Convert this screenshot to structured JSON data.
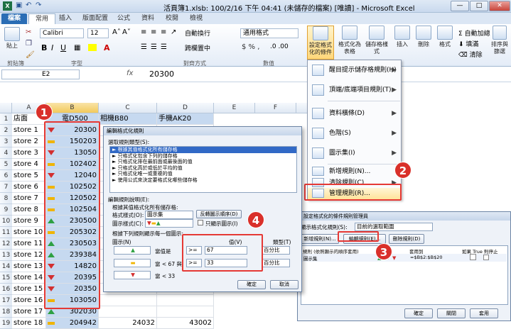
{
  "window": {
    "title": "活頁簿1.xlsb: 100/2/16 下午 04:41 (未儲存的檔案) [唯讀] - Microsoft Excel",
    "minimize": "—",
    "maximize": "□",
    "close": "✕"
  },
  "tabs": [
    {
      "label": "檔案"
    },
    {
      "label": "常用"
    },
    {
      "label": "插入"
    },
    {
      "label": "版面配置"
    },
    {
      "label": "公式"
    },
    {
      "label": "資料"
    },
    {
      "label": "校閱"
    },
    {
      "label": "檢視"
    }
  ],
  "ribbon": {
    "paste": "貼上",
    "font": "Calibri",
    "size": "12",
    "wrap": "自動換行",
    "numfmt": "通用格式",
    "merge": "跨欄置中",
    "cond_format": "設定格式化的條件",
    "table_format": "格式化為表格",
    "cell_style": "儲存格樣式",
    "insert": "插入",
    "delete": "刪除",
    "format": "格式",
    "autosum": "自動加總",
    "fill": "填滿",
    "clear": "清除",
    "sort": "排序與篩選",
    "groups": {
      "clipboard": "剪貼簿",
      "font": "字型",
      "align": "對齊方式",
      "number": "數值"
    }
  },
  "formula": {
    "namebox": "E2",
    "fx": "fx",
    "value": "20300"
  },
  "columns": [
    "A",
    "B",
    "C",
    "D",
    "E",
    "F",
    "G"
  ],
  "headers": {
    "a": "店面",
    "b": "電D500",
    "c": "相機B80",
    "d": "手機AK20"
  },
  "rows": [
    {
      "n": "1"
    },
    {
      "n": "2",
      "a": "store 1",
      "b": "20300",
      "icon": "down"
    },
    {
      "n": "3",
      "a": "store 2",
      "b": "150203",
      "icon": "mid"
    },
    {
      "n": "4",
      "a": "store 3",
      "b": "13050",
      "icon": "down"
    },
    {
      "n": "5",
      "a": "store 4",
      "b": "102402",
      "icon": "mid"
    },
    {
      "n": "6",
      "a": "store 5",
      "b": "12040",
      "icon": "down"
    },
    {
      "n": "7",
      "a": "store 6",
      "b": "102502",
      "icon": "mid"
    },
    {
      "n": "8",
      "a": "store 7",
      "b": "120502",
      "icon": "mid"
    },
    {
      "n": "9",
      "a": "store 8",
      "b": "102504",
      "icon": "mid"
    },
    {
      "n": "10",
      "a": "store 9",
      "b": "230500",
      "icon": "up"
    },
    {
      "n": "11",
      "a": "store 10",
      "b": "205302",
      "icon": "mid"
    },
    {
      "n": "12",
      "a": "store 11",
      "b": "230503",
      "icon": "up"
    },
    {
      "n": "13",
      "a": "store 12",
      "b": "239384",
      "icon": "up"
    },
    {
      "n": "14",
      "a": "store 13",
      "b": "14820",
      "icon": "down"
    },
    {
      "n": "15",
      "a": "store 14",
      "b": "20395",
      "icon": "down"
    },
    {
      "n": "16",
      "a": "store 15",
      "b": "20350",
      "icon": "down"
    },
    {
      "n": "17",
      "a": "store 16",
      "b": "103050",
      "icon": "mid"
    },
    {
      "n": "18",
      "a": "store 17",
      "b": "302030",
      "icon": "up"
    },
    {
      "n": "19",
      "a": "store 18",
      "b": "204942",
      "icon": "mid"
    },
    {
      "n": "20",
      "a": "store 19",
      "b": "20501",
      "icon": "down",
      "c": "50304",
      "d": "43002"
    },
    {
      "n": "21"
    }
  ],
  "row19_partial": {
    "c": "24032",
    "d": "43002"
  },
  "menu": [
    {
      "label": "醒目提示儲存格規則(H)",
      "arrow": "▶"
    },
    {
      "label": "頂端/底端項目規則(T)",
      "arrow": "▶"
    },
    {
      "label": "資料橫條(D)",
      "arrow": "▶"
    },
    {
      "label": "色階(S)",
      "arrow": "▶"
    },
    {
      "label": "圖示集(I)",
      "arrow": "▶"
    },
    {
      "label": "新增規則(N)...",
      "arrow": ""
    },
    {
      "label": "清除規則(C)",
      "arrow": "▶"
    },
    {
      "label": "管理規則(R)...",
      "arrow": ""
    }
  ],
  "dialog": {
    "title": "編輯格式化規則",
    "select_label": "選取規則類型(S):",
    "rule_types": [
      "► 根據其值格式化所有儲存格",
      "► 只格式化包含下列的儲存格",
      "► 只格式化排在最前面或最後面的值",
      "► 只格式化高於或低於平均的值",
      "► 只格式化唯一或重複的值",
      "► 使用公式來決定要格式化哪些儲存格"
    ],
    "edit_label": "編輯規則說明(E):",
    "desc_label": "根據其值格式化所有儲存格:",
    "style_label": "格式樣式(O):",
    "style_value": "圖示集",
    "reverse": "反轉圖示順序(D)",
    "icon_style": "圖示樣式(C):",
    "show_icon_only": "只顯示圖示(I)",
    "rule_label": "根據下列規則顯示每一個圖示:",
    "icon_col": "圖示(N)",
    "value_col": "值(V)",
    "type_col": "類型(T)",
    "when1": "當值是",
    ">": ">=",
    "v1": "67",
    "t1": "百分比",
    "when2": "當 < 67 與",
    "v2": "33",
    "t2": "百分比",
    "when3": "當 < 33",
    "ok": "確定",
    "cancel": "取消"
  },
  "manager": {
    "title": "設定格式化的條件規則管理員",
    "show_label": "顯示格式化規則(S):",
    "show_value": "目前的選取範圍",
    "new": "新增規則(N)...",
    "edit": "編輯規則(E)...",
    "delete": "刪除規則(D)",
    "col_rule": "規則 (依照顯示的順序套用)",
    "col_format": "格式",
    "col_applies": "套用到",
    "col_stop": "如果 True 則停止",
    "row_rule": "圖示集",
    "row_applies": "=$B$2:$B$20",
    "ok": "確定",
    "close": "關閉",
    "apply": "套用"
  },
  "badges": [
    "1",
    "2",
    "3",
    "4"
  ]
}
